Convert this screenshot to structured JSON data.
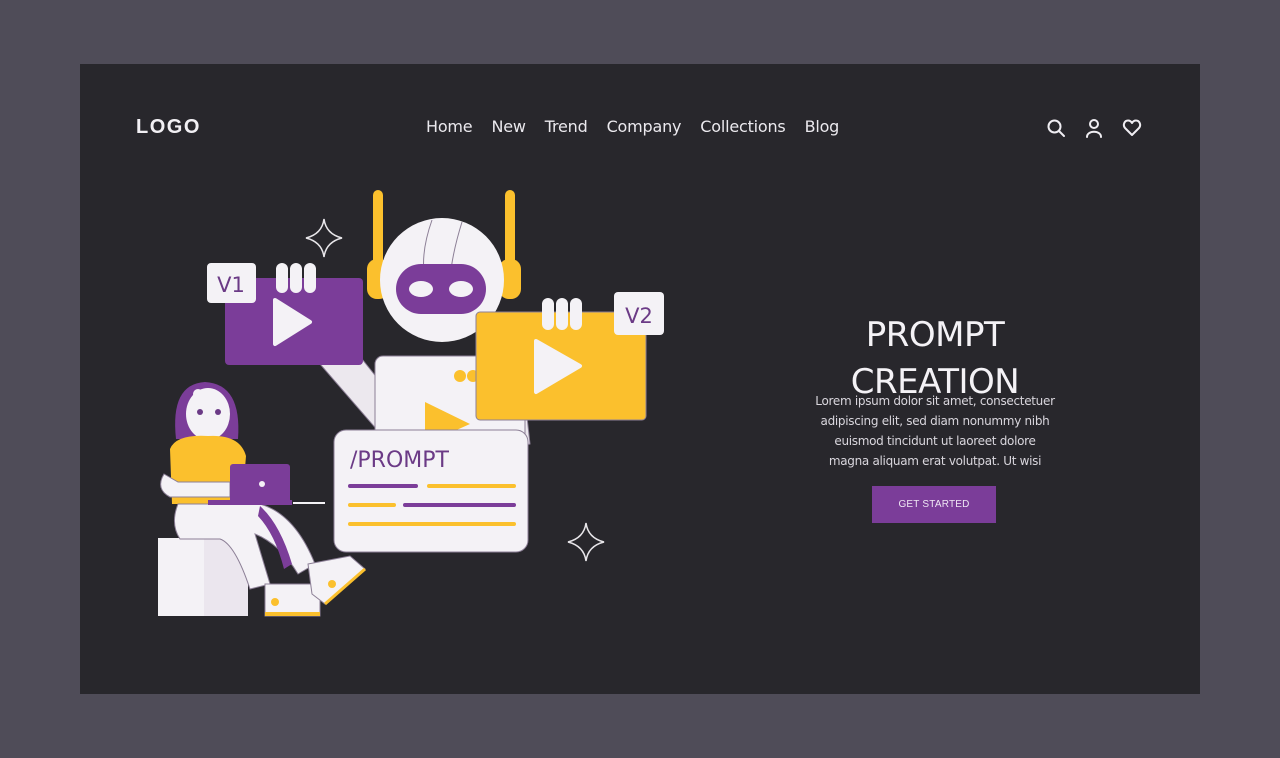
{
  "header": {
    "logo": "LOGO",
    "nav": [
      {
        "label": "Home"
      },
      {
        "label": "New"
      },
      {
        "label": "Trend"
      },
      {
        "label": "Company"
      },
      {
        "label": "Collections"
      },
      {
        "label": "Blog"
      }
    ],
    "icons": [
      "search-icon",
      "user-icon",
      "heart-icon"
    ]
  },
  "hero": {
    "title_line1": "PROMPT",
    "title_line2": "CREATION",
    "body_lines": [
      "Lorem ipsum dolor sit amet, consectetuer",
      "adipiscing elit, sed diam nonummy nibh",
      "euismod tincidunt ut laoreet dolore",
      "magna aliquam erat volutpat. Ut wisi"
    ],
    "cta_label": "GET STARTED"
  },
  "illustration": {
    "card_v1_label": "V1",
    "card_v2_label": "V2",
    "prompt_label": "/PROMPT"
  },
  "colors": {
    "background_outer": "#4f4c58",
    "panel": "#28272c",
    "purple": "#7b3d99",
    "yellow": "#fbc02d",
    "offwhite": "#f4f2f6"
  }
}
